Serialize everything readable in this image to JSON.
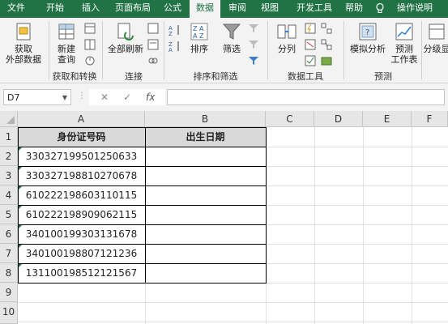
{
  "tabs": [
    "文件",
    "开始",
    "插入",
    "页面布局",
    "公式",
    "数据",
    "审阅",
    "视图",
    "开发工具",
    "帮助"
  ],
  "tell_me": "操作说明",
  "ribbon": {
    "get_external": [
      "获取",
      "外部数据"
    ],
    "new_query": [
      "新建",
      "查询"
    ],
    "group_get_transform": "获取和转换",
    "refresh_all": "全部刷新",
    "group_connections": "连接",
    "sort": "排序",
    "filter": "筛选",
    "group_sort_filter": "排序和筛选",
    "text_to_columns": "分列",
    "group_data_tools": "数据工具",
    "what_if": "模拟分析",
    "forecast_sheet": [
      "预测",
      "工作表"
    ],
    "group_forecast": "预测",
    "outline": "分级显"
  },
  "formula_bar": {
    "name_box": "D7",
    "fx": "fx",
    "formula": ""
  },
  "columns": [
    "A",
    "B",
    "C",
    "D",
    "E",
    "F"
  ],
  "rows": [
    "1",
    "2",
    "3",
    "4",
    "5",
    "6",
    "7",
    "8",
    "9",
    "10"
  ],
  "table": {
    "headers": [
      "身份证号码",
      "出生日期"
    ],
    "ids": [
      "330327199501250633",
      "330327198810270678",
      "610222198603110115",
      "610222198909062115",
      "340100199303131678",
      "340100198807121236",
      "131100198512121567"
    ],
    "dates": [
      "",
      "",
      "",
      "",
      "",
      "",
      ""
    ]
  },
  "colors": {
    "tab_bar": "#217346",
    "header_fill": "#d9d9d9",
    "error_triangle": "#1e7145"
  }
}
